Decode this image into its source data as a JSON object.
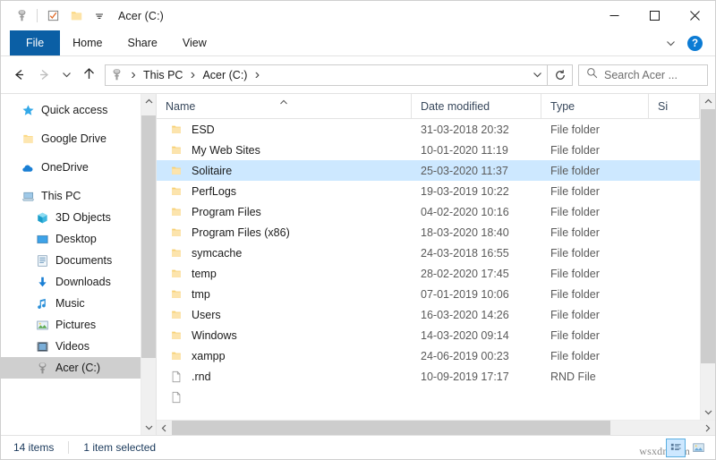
{
  "window": {
    "title": "Acer (C:)",
    "quick_access_toolbar": [
      {
        "name": "properties-icon",
        "label": "Properties"
      },
      {
        "name": "checkbox-icon",
        "label": "Check boxes"
      },
      {
        "name": "folder-icon",
        "label": "New folder"
      },
      {
        "name": "chevron-down-icon",
        "label": "Customize Quick Access Toolbar"
      }
    ],
    "controls": {
      "minimize": "–",
      "maximize": "□",
      "close": "✕"
    }
  },
  "ribbon": {
    "tabs": [
      {
        "label": "File",
        "active": true
      },
      {
        "label": "Home",
        "active": false
      },
      {
        "label": "Share",
        "active": false
      },
      {
        "label": "View",
        "active": false
      }
    ],
    "collapse_label": "Minimize the Ribbon",
    "help_label": "?"
  },
  "address": {
    "back_label": "Back",
    "forward_label": "Forward",
    "recent_label": "Recent locations",
    "up_label": "Up",
    "breadcrumbs": [
      "This PC",
      "Acer (C:)"
    ],
    "separator": "›",
    "refresh_label": "Refresh"
  },
  "search": {
    "placeholder": "Search Acer ...",
    "value": ""
  },
  "sidebar": {
    "items": [
      {
        "label": "Quick access",
        "icon": "star-icon",
        "indent": false,
        "selected": false
      },
      {
        "label": "Google Drive",
        "icon": "folder-icon",
        "indent": false,
        "selected": false
      },
      {
        "label": "OneDrive",
        "icon": "cloud-icon",
        "indent": false,
        "selected": false
      },
      {
        "label": "This PC",
        "icon": "computer-icon",
        "indent": false,
        "selected": false
      },
      {
        "label": "3D Objects",
        "icon": "cube-icon",
        "indent": true,
        "selected": false
      },
      {
        "label": "Desktop",
        "icon": "desktop-icon",
        "indent": true,
        "selected": false
      },
      {
        "label": "Documents",
        "icon": "documents-icon",
        "indent": true,
        "selected": false
      },
      {
        "label": "Downloads",
        "icon": "downloads-icon",
        "indent": true,
        "selected": false
      },
      {
        "label": "Music",
        "icon": "music-icon",
        "indent": true,
        "selected": false
      },
      {
        "label": "Pictures",
        "icon": "pictures-icon",
        "indent": true,
        "selected": false
      },
      {
        "label": "Videos",
        "icon": "videos-icon",
        "indent": true,
        "selected": false
      },
      {
        "label": "Acer (C:)",
        "icon": "harddrive-icon",
        "indent": true,
        "selected": true
      }
    ]
  },
  "filelist": {
    "columns": [
      {
        "label": "Name",
        "sorted": true,
        "sort_dir": "asc"
      },
      {
        "label": "Date modified",
        "sorted": false
      },
      {
        "label": "Type",
        "sorted": false
      },
      {
        "label": "Si",
        "sorted": false
      }
    ],
    "rows": [
      {
        "name": "ESD",
        "date": "31-03-2018 20:32",
        "type": "File folder",
        "size": "",
        "icon": "folder-icon",
        "selected": false
      },
      {
        "name": "My Web Sites",
        "date": "10-01-2020 11:19",
        "type": "File folder",
        "size": "",
        "icon": "folder-icon",
        "selected": false
      },
      {
        "name": "Solitaire",
        "date": "25-03-2020 11:37",
        "type": "File folder",
        "size": "",
        "icon": "folder-icon",
        "selected": true
      },
      {
        "name": "PerfLogs",
        "date": "19-03-2019 10:22",
        "type": "File folder",
        "size": "",
        "icon": "folder-icon",
        "selected": false
      },
      {
        "name": "Program Files",
        "date": "04-02-2020 10:16",
        "type": "File folder",
        "size": "",
        "icon": "folder-icon",
        "selected": false
      },
      {
        "name": "Program Files (x86)",
        "date": "18-03-2020 18:40",
        "type": "File folder",
        "size": "",
        "icon": "folder-icon",
        "selected": false
      },
      {
        "name": "symcache",
        "date": "24-03-2018 16:55",
        "type": "File folder",
        "size": "",
        "icon": "folder-icon",
        "selected": false
      },
      {
        "name": "temp",
        "date": "28-02-2020 17:45",
        "type": "File folder",
        "size": "",
        "icon": "folder-icon",
        "selected": false
      },
      {
        "name": "tmp",
        "date": "07-01-2019 10:06",
        "type": "File folder",
        "size": "",
        "icon": "folder-icon",
        "selected": false
      },
      {
        "name": "Users",
        "date": "16-03-2020 14:26",
        "type": "File folder",
        "size": "",
        "icon": "folder-icon",
        "selected": false
      },
      {
        "name": "Windows",
        "date": "14-03-2020 09:14",
        "type": "File folder",
        "size": "",
        "icon": "folder-icon",
        "selected": false
      },
      {
        "name": "xampp",
        "date": "24-06-2019 00:23",
        "type": "File folder",
        "size": "",
        "icon": "folder-icon",
        "selected": false
      },
      {
        "name": ".rnd",
        "date": "10-09-2019 17:17",
        "type": "RND File",
        "size": "",
        "icon": "file-icon",
        "selected": false
      },
      {
        "name": "",
        "date": "",
        "type": "",
        "size": "",
        "icon": "file-icon",
        "selected": false
      }
    ]
  },
  "statusbar": {
    "item_count": "14 items",
    "selection": "1 item selected",
    "views": [
      {
        "name": "details-view-button",
        "label": "Details view",
        "active": true
      },
      {
        "name": "large-icons-view-button",
        "label": "Large icons view",
        "active": false
      }
    ]
  },
  "watermark": "wsxdn.com"
}
